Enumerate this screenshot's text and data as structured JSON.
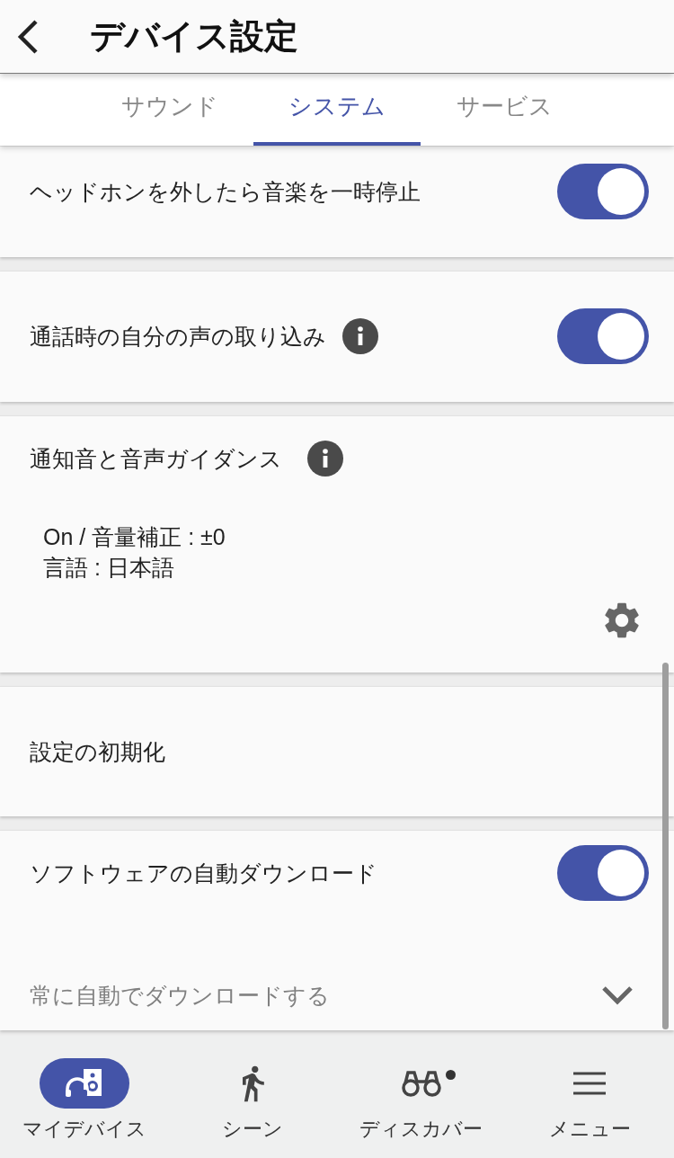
{
  "header": {
    "title": "デバイス設定"
  },
  "tabs": [
    {
      "label": "サウンド",
      "selected": false
    },
    {
      "label": "システム",
      "selected": true
    },
    {
      "label": "サービス",
      "selected": false
    }
  ],
  "settings": [
    {
      "kind": "toggle",
      "label": "ヘッドホンを外したら音楽を一時停止",
      "on": true
    },
    {
      "kind": "toggle",
      "label": "通話時の自分の声の取り込み",
      "info": true,
      "on": true
    },
    {
      "kind": "detail",
      "label": "通知音と音声ガイダンス",
      "info": true,
      "lines": [
        "On / 音量補正 : ±0",
        "言語 : 日本語"
      ]
    },
    {
      "kind": "action",
      "label": "設定の初期化"
    },
    {
      "kind": "toggle",
      "label": "ソフトウェアの自動ダウンロード",
      "on": true,
      "option": "常に自動でダウンロードする"
    }
  ],
  "navigation": [
    {
      "label": "マイデバイス",
      "selected": true
    },
    {
      "label": "シーン",
      "selected": false
    },
    {
      "label": "ディスカバー",
      "selected": false,
      "badge": true
    },
    {
      "label": "メニュー",
      "selected": false
    }
  ]
}
